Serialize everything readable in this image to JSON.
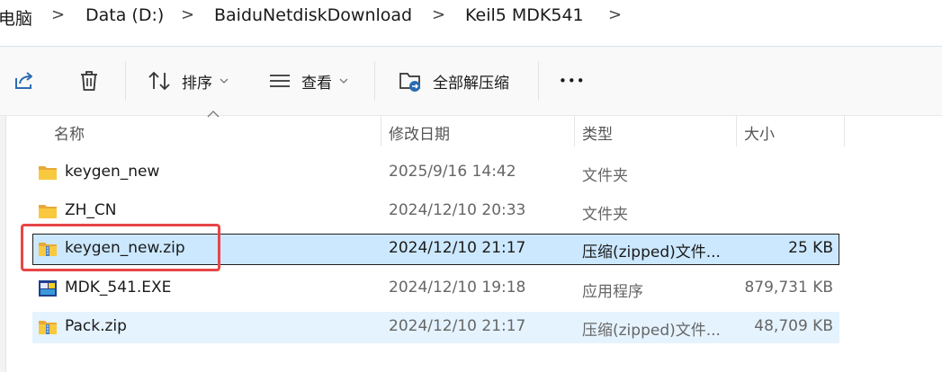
{
  "breadcrumb": {
    "items": [
      "电脑",
      "Data (D:)",
      "BaiduNetdiskDownload",
      "Keil5 MDK541"
    ],
    "separator": ">"
  },
  "toolbar": {
    "sort_label": "排序",
    "view_label": "查看",
    "extract_label": "全部解压缩",
    "more_label": "•••"
  },
  "columns": {
    "name": "名称",
    "date": "修改日期",
    "type": "类型",
    "size": "大小"
  },
  "files": [
    {
      "name": "keygen_new",
      "date": "2025/9/16 14:42",
      "type": "文件夹",
      "size": "",
      "icon": "folder-icon"
    },
    {
      "name": "ZH_CN",
      "date": "2024/12/10 20:33",
      "type": "文件夹",
      "size": "",
      "icon": "folder-icon"
    },
    {
      "name": "keygen_new.zip",
      "date": "2024/12/10 21:17",
      "type": "压缩(zipped)文件...",
      "size": "25 KB",
      "icon": "zip-folder-icon",
      "selected": true
    },
    {
      "name": "MDK_541.EXE",
      "date": "2024/12/10 19:18",
      "type": "应用程序",
      "size": "879,731 KB",
      "icon": "exe-icon"
    },
    {
      "name": "Pack.zip",
      "date": "2024/12/10 21:17",
      "type": "压缩(zipped)文件...",
      "size": "48,709 KB",
      "icon": "zip-folder-icon",
      "hovered": true
    }
  ],
  "colors": {
    "selection": "#cce8ff",
    "hover": "#e5f3ff",
    "annotation": "#e84545",
    "folder": "#f8c93e"
  }
}
